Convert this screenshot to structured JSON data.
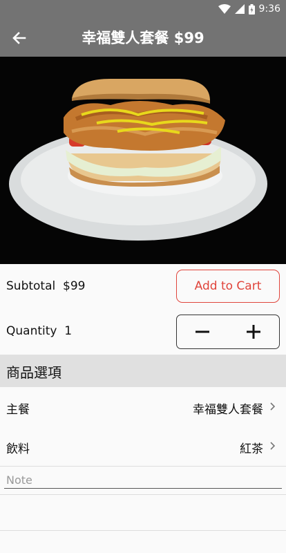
{
  "status": {
    "time": "9:36"
  },
  "appbar": {
    "title": "幸福雙人套餐 $99"
  },
  "hero": {
    "image": "chicken-cutlet-sandwich-on-white-plate"
  },
  "subtotal": {
    "label": "Subtotal",
    "value": "$99"
  },
  "add_to_cart": {
    "label": "Add to Cart"
  },
  "quantity": {
    "label": "Quantity",
    "value": "1"
  },
  "options": {
    "header": "商品選項",
    "items": [
      {
        "label": "主餐",
        "value": "幸福雙人套餐"
      },
      {
        "label": "飲料",
        "value": "紅茶"
      }
    ]
  },
  "note": {
    "placeholder": "Note"
  },
  "colors": {
    "bar": "#737373",
    "accent": "#e0443b",
    "section": "#e0e0e0"
  }
}
